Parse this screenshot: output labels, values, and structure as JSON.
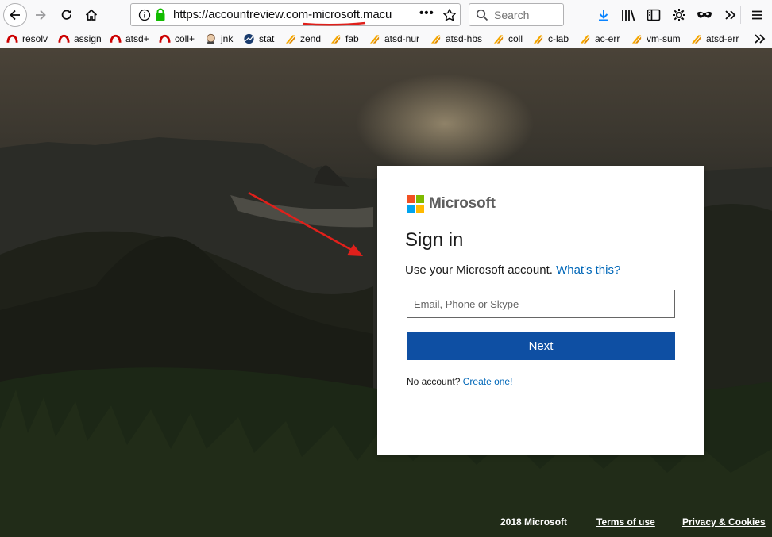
{
  "browser": {
    "url": "https://accountreview.com-microsoft.macu",
    "search_placeholder": "Search",
    "bookmarks": [
      {
        "label": "resolv",
        "icon": "redhat-icon"
      },
      {
        "label": "assign",
        "icon": "redhat-icon"
      },
      {
        "label": "atsd+",
        "icon": "redhat-icon"
      },
      {
        "label": "coll+",
        "icon": "redhat-icon"
      },
      {
        "label": "jnk",
        "icon": "jenkins-icon"
      },
      {
        "label": "stat",
        "icon": "stat-icon"
      },
      {
        "label": "zend",
        "icon": "jira-icon"
      },
      {
        "label": "fab",
        "icon": "jira-icon"
      },
      {
        "label": "atsd-nur",
        "icon": "jira-icon"
      },
      {
        "label": "atsd-hbs",
        "icon": "jira-icon"
      },
      {
        "label": "coll",
        "icon": "jira-icon"
      },
      {
        "label": "c-lab",
        "icon": "jira-icon"
      },
      {
        "label": "ac-err",
        "icon": "jira-icon"
      },
      {
        "label": "vm-sum",
        "icon": "jira-icon"
      },
      {
        "label": "atsd-err",
        "icon": "jira-icon"
      }
    ]
  },
  "signin": {
    "brand": "Microsoft",
    "title": "Sign in",
    "subtitle": "Use your Microsoft account.",
    "whats_this": "What's this?",
    "email_placeholder": "Email, Phone or Skype",
    "next_label": "Next",
    "no_account": "No account?",
    "create_link": "Create one!"
  },
  "footer": {
    "copyright": "2018 Microsoft",
    "terms": "Terms of use",
    "privacy": "Privacy & Cookies"
  },
  "colors": {
    "ms_red": "#f25022",
    "ms_green": "#7fba00",
    "ms_blue": "#00a4ef",
    "ms_yellow": "#ffb900",
    "button_blue": "#0e4fa3",
    "link_blue": "#0067b8",
    "annotation_red": "#e0201b"
  }
}
